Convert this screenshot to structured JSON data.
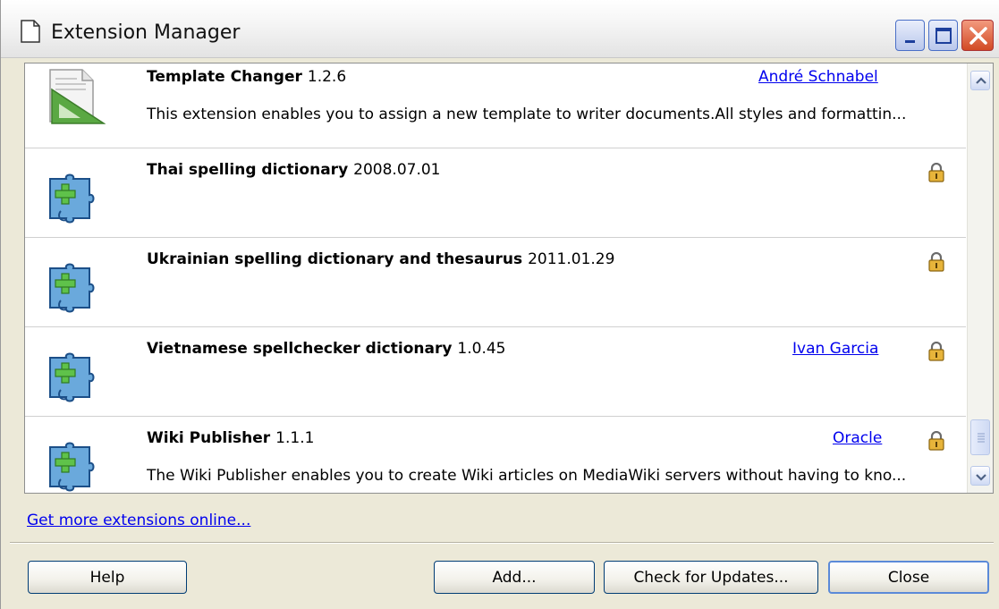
{
  "window": {
    "title": "Extension Manager"
  },
  "extensions": [
    {
      "name": "Template Changer",
      "version": "1.2.6",
      "author": "André Schnabel",
      "description": "This extension enables you to assign a new template to writer documents.All styles and formattin...",
      "icon": "template-changer-icon",
      "locked": false
    },
    {
      "name": "Thai spelling dictionary",
      "version": "2008.07.01",
      "author": "",
      "description": "",
      "icon": "puzzle-icon",
      "locked": true
    },
    {
      "name": "Ukrainian spelling dictionary and thesaurus",
      "version": "2011.01.29",
      "author": "",
      "description": "",
      "icon": "puzzle-icon",
      "locked": true
    },
    {
      "name": "Vietnamese spellchecker dictionary",
      "version": "1.0.45",
      "author": "Ivan Garcia",
      "description": "",
      "icon": "puzzle-icon",
      "locked": true
    },
    {
      "name": "Wiki Publisher",
      "version": "1.1.1",
      "author": "Oracle",
      "description": "The Wiki Publisher enables you to create Wiki articles on MediaWiki servers without having to kno...",
      "icon": "puzzle-icon",
      "locked": true
    }
  ],
  "links": {
    "more_extensions": "Get more extensions online..."
  },
  "buttons": {
    "help": "Help",
    "add": "Add...",
    "check_updates": "Check for Updates...",
    "close": "Close"
  },
  "colors": {
    "link": "#0000ee",
    "dialog_bg": "#ece9d8",
    "puzzle": "#6aa9dc",
    "puzzle_plus": "#5fc24a"
  }
}
